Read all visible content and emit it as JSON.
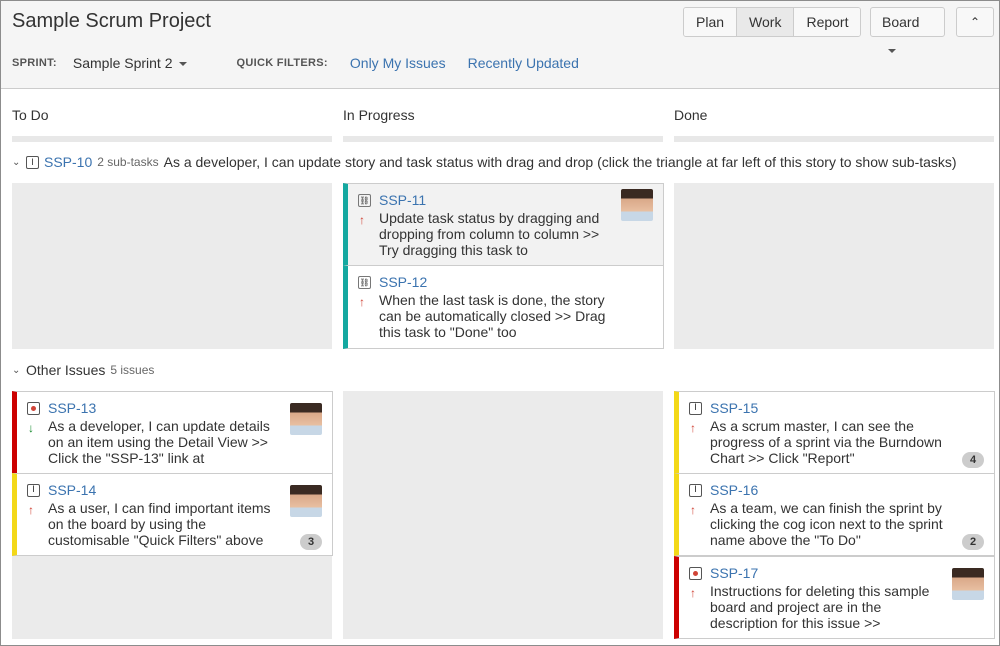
{
  "project": {
    "title": "Sample Scrum Project"
  },
  "modes": [
    {
      "label": "Plan",
      "active": false
    },
    {
      "label": "Work",
      "active": true
    },
    {
      "label": "Report",
      "active": false
    }
  ],
  "board_button": {
    "label": "Board"
  },
  "collapse_button": {
    "glyph": "⌃"
  },
  "filters": {
    "sprint_label": "SPRINT:",
    "sprint_name": "Sample Sprint 2",
    "quick_filters_label": "QUICK FILTERS:",
    "quick_filters": [
      "Only My Issues",
      "Recently Updated"
    ]
  },
  "columns": [
    "To Do",
    "In Progress",
    "Done"
  ],
  "lanes": {
    "story": {
      "key": "SSP-10",
      "subtasks": "2 sub-tasks",
      "summary": "As a developer, I can update story and task status with drag and drop (click the triangle at far left of this story to show sub-tasks)"
    },
    "other": {
      "title": "Other Issues",
      "count": "5 issues"
    }
  },
  "cards": {
    "ssp11": {
      "key": "SSP-11",
      "summary": "Update task status by dragging and dropping from column to column >> Try dragging this task to"
    },
    "ssp12": {
      "key": "SSP-12",
      "summary": "When the last task is done, the story can be automatically closed >> Drag this task to \"Done\" too"
    },
    "ssp13": {
      "key": "SSP-13",
      "summary": "As a developer, I can update details on an item using the Detail View >> Click the \"SSP-13\" link at"
    },
    "ssp14": {
      "key": "SSP-14",
      "summary": "As a user, I can find important items on the board by using the customisable \"Quick Filters\" above",
      "badge": "3"
    },
    "ssp15": {
      "key": "SSP-15",
      "summary": "As a scrum master, I can see the progress of a sprint via the Burndown Chart >> Click \"Report\"",
      "badge": "4"
    },
    "ssp16": {
      "key": "SSP-16",
      "summary": "As a team, we can finish the sprint by clicking the cog icon next to the sprint name above the \"To Do\"",
      "badge": "2"
    },
    "ssp17": {
      "key": "SSP-17",
      "summary": "Instructions for deleting this sample board and project are in the description for this issue >>"
    }
  },
  "colors": {
    "link": "#3b73af",
    "in_progress_edge": "#14a8a0",
    "bug_edge": "#cc0000",
    "story_edge": "#f3d818"
  }
}
